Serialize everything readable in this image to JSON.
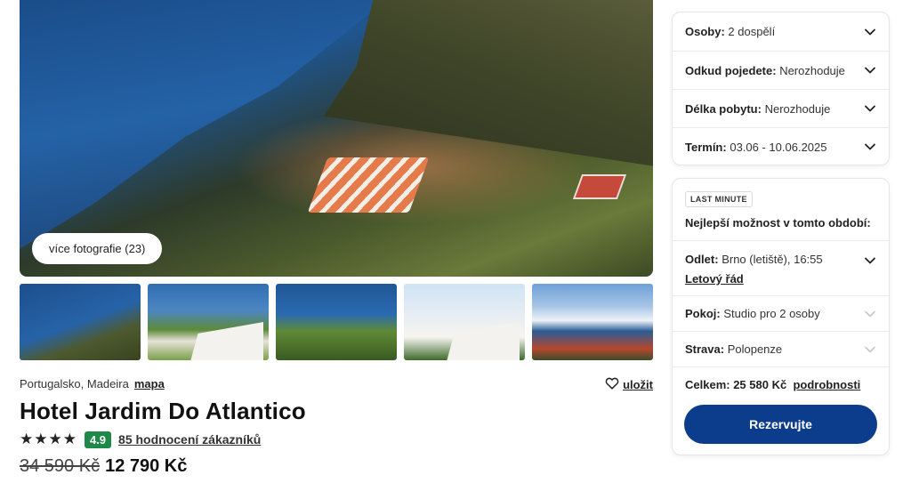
{
  "gallery": {
    "more_photos_label": "více fotografie (23)",
    "thumbnail_count": 5
  },
  "hotel": {
    "location": "Portugalsko, Madeira",
    "map_link": "mapa",
    "save_label": "uložit",
    "name": "Hotel Jardim Do Atlantico",
    "stars": 4,
    "stars_glyphs": "★★★★",
    "score": "4.9",
    "reviews_link": "85 hodnocení zákazníků",
    "old_price": "34 590 Kč",
    "new_price": "12 790 Kč"
  },
  "filters": {
    "persons": {
      "label": "Osoby:",
      "value": "2 dospělí"
    },
    "departure": {
      "label": "Odkud pojedete:",
      "value": "Nerozhoduje"
    },
    "length": {
      "label": "Délka pobytu:",
      "value": "Nerozhoduje"
    },
    "term": {
      "label": "Termín:",
      "value": "03.06 - 10.06.2025"
    }
  },
  "offer": {
    "badge": "LAST MINUTE",
    "heading": "Nejlepší možnost v tomto období:",
    "flight": {
      "label": "Odlet:",
      "value": "Brno (letiště), 16:55",
      "schedule_link": "Letový řád"
    },
    "room": {
      "label": "Pokoj:",
      "value": "Studio pro 2 osoby"
    },
    "board": {
      "label": "Strava:",
      "value": "Polopenze"
    },
    "total": {
      "label": "Celkem:",
      "value": "25 580 Kč",
      "details_link": "podrobnosti"
    },
    "reserve_label": "Rezervujte"
  },
  "colors": {
    "accent": "#0c3c8c",
    "score_bg": "#1f8a48"
  }
}
